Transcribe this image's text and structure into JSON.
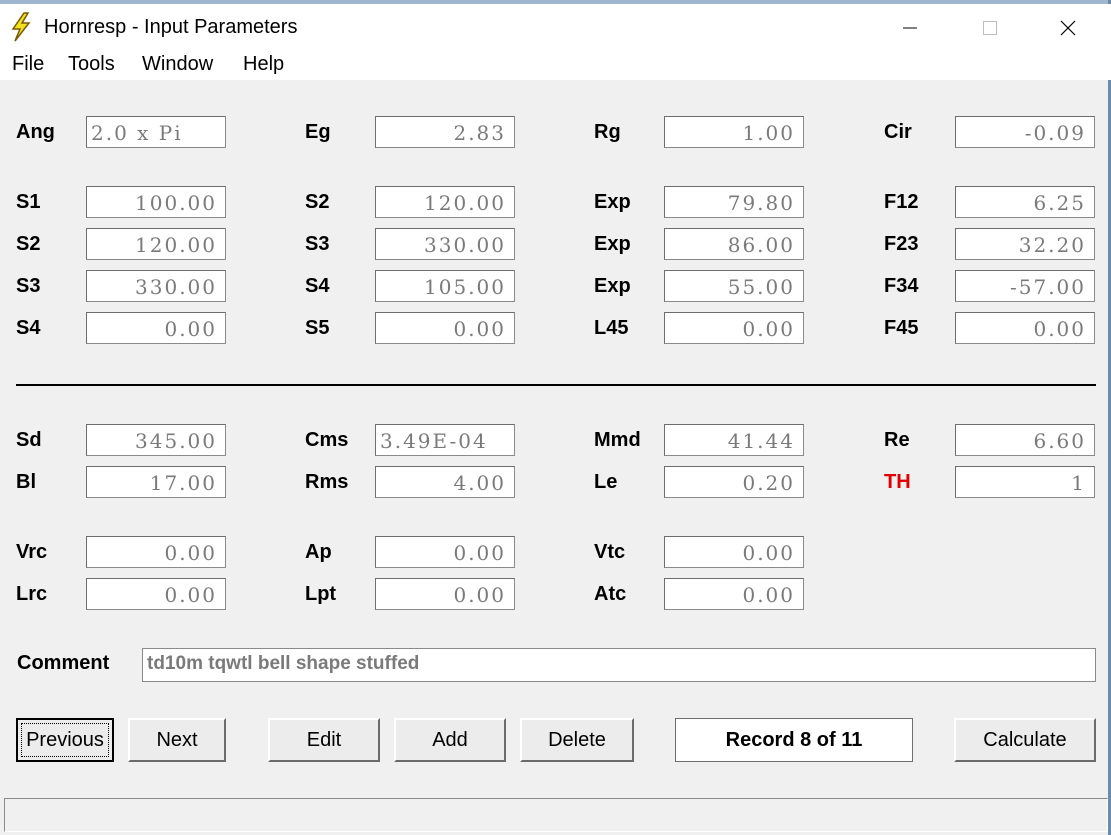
{
  "window": {
    "title": "Hornresp - Input Parameters",
    "icon": "lightning-icon",
    "controls": [
      "minimize-icon",
      "maximize-icon",
      "close-icon"
    ]
  },
  "menu": [
    "File",
    "Tools",
    "Window",
    "Help"
  ],
  "top": {
    "ang": {
      "label": "Ang",
      "value": "2.0 x Pi"
    },
    "eg": {
      "label": "Eg",
      "value": "2.83"
    },
    "rg": {
      "label": "Rg",
      "value": "1.00"
    },
    "cir": {
      "label": "Cir",
      "value": "-0.09"
    }
  },
  "horn": [
    [
      {
        "label": "S1",
        "value": "100.00"
      },
      {
        "label": "S2",
        "value": "120.00"
      },
      {
        "label": "Exp",
        "value": "79.80"
      },
      {
        "label": "F12",
        "value": "6.25"
      }
    ],
    [
      {
        "label": "S2",
        "value": "120.00"
      },
      {
        "label": "S3",
        "value": "330.00"
      },
      {
        "label": "Exp",
        "value": "86.00"
      },
      {
        "label": "F23",
        "value": "32.20"
      }
    ],
    [
      {
        "label": "S3",
        "value": "330.00"
      },
      {
        "label": "S4",
        "value": "105.00"
      },
      {
        "label": "Exp",
        "value": "55.00"
      },
      {
        "label": "F34",
        "value": "-57.00"
      }
    ],
    [
      {
        "label": "S4",
        "value": "0.00"
      },
      {
        "label": "S5",
        "value": "0.00"
      },
      {
        "label": "L45",
        "value": "0.00"
      },
      {
        "label": "F45",
        "value": "0.00"
      }
    ]
  ],
  "driver": [
    [
      {
        "label": "Sd",
        "value": "345.00"
      },
      {
        "label": "Cms",
        "value": "3.49E-04"
      },
      {
        "label": "Mmd",
        "value": "41.44"
      },
      {
        "label": "Re",
        "value": "6.60"
      }
    ],
    [
      {
        "label": "Bl",
        "value": "17.00"
      },
      {
        "label": "Rms",
        "value": "4.00"
      },
      {
        "label": "Le",
        "value": "0.20"
      },
      {
        "label": "TH",
        "value": "1"
      }
    ]
  ],
  "chambers": [
    [
      {
        "label": "Vrc",
        "value": "0.00"
      },
      {
        "label": "Ap",
        "value": "0.00"
      },
      {
        "label": "Vtc",
        "value": "0.00"
      }
    ],
    [
      {
        "label": "Lrc",
        "value": "0.00"
      },
      {
        "label": "Lpt",
        "value": "0.00"
      },
      {
        "label": "Atc",
        "value": "0.00"
      }
    ]
  ],
  "comment": {
    "label": "Comment",
    "value": "td10m tqwtl bell shape stuffed"
  },
  "buttons": {
    "previous": "Previous",
    "next": "Next",
    "edit": "Edit",
    "add": "Add",
    "delete": "Delete",
    "calculate": "Calculate"
  },
  "record": "Record 8 of 11",
  "colors": {
    "highlight_label": "#e00000",
    "field_text": "#7a7a7a"
  }
}
